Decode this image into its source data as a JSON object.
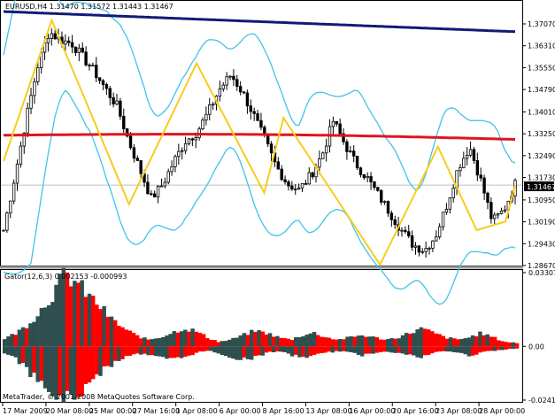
{
  "main": {
    "header": "EURUSD,H4  1.31470 1.31572 1.31443 1.31467",
    "price_ticks": [
      "1.37070",
      "1.36310",
      "1.35550",
      "1.34790",
      "1.34010",
      "1.33250",
      "1.32490",
      "1.31730",
      "1.30950",
      "1.30190",
      "1.29430",
      "1.28670"
    ],
    "current_price": "1.31467"
  },
  "indicator": {
    "header": "Gator(12,6,3) 0.002153 -0.000993",
    "ticks": [
      "0.033079",
      "0.00",
      "-0.024121"
    ]
  },
  "time_axis": {
    "labels": [
      "17 Mar 2009",
      "20 Mar 08:00",
      "25 Mar 00:00",
      "27 Mar 16:00",
      "1 Apr 08:00",
      "6 Apr 00:00",
      "8 Apr 16:00",
      "13 Apr 08:00",
      "16 Apr 00:00",
      "20 Apr 16:00",
      "23 Apr 08:00",
      "28 Apr 00:00"
    ]
  },
  "copyright": "MetaTrader, © 2001-2008 MetaQuotes Software Corp.",
  "colors": {
    "candles": "#000000",
    "bollinger": "#3fc4e8",
    "ma_red": "#e0141e",
    "ma_navy": "#101a78",
    "zigzag": "#f8cc1e",
    "gator_up": "#2f4f4f",
    "gator_down": "#ff0000"
  },
  "chart_data": [
    {
      "type": "candlestick",
      "title": "EURUSD,H4",
      "ylim": [
        1.2867,
        1.3707
      ],
      "x": [
        "17 Mar 2009",
        "20 Mar 08:00",
        "25 Mar 00:00",
        "27 Mar 16:00",
        "1 Apr 08:00",
        "6 Apr 00:00",
        "8 Apr 16:00",
        "13 Apr 08:00",
        "16 Apr 00:00",
        "20 Apr 16:00",
        "23 Apr 08:00",
        "28 Apr 00:00"
      ],
      "close_path": [
        1.299,
        1.318,
        1.338,
        1.356,
        1.368,
        1.365,
        1.364,
        1.359,
        1.354,
        1.348,
        1.342,
        1.33,
        1.32,
        1.31,
        1.315,
        1.323,
        1.33,
        1.333,
        1.34,
        1.348,
        1.353,
        1.347,
        1.339,
        1.33,
        1.321,
        1.315,
        1.313,
        1.318,
        1.325,
        1.337,
        1.329,
        1.322,
        1.317,
        1.311,
        1.305,
        1.299,
        1.294,
        1.292,
        1.297,
        1.308,
        1.321,
        1.328,
        1.316,
        1.302,
        1.306,
        1.315
      ],
      "series": [
        {
          "name": "zigzag",
          "x_index": [
            0,
            5,
            13,
            20,
            27,
            29,
            39,
            45,
            49,
            52,
            53
          ],
          "values": [
            1.323,
            1.372,
            1.308,
            1.357,
            1.312,
            1.338,
            1.287,
            1.328,
            1.299,
            1.302,
            1.3146
          ]
        }
      ]
    },
    {
      "type": "bar",
      "title": "Gator(12,6,3)",
      "ylim": [
        -0.024121,
        0.033079
      ],
      "series": [
        {
          "name": "upper",
          "values_profile": [
            0.0035,
            0.006,
            0.01,
            0.016,
            0.023,
            0.032,
            0.029,
            0.023,
            0.018,
            0.012,
            0.008,
            0.005,
            0.003,
            0.004,
            0.006,
            0.008,
            0.007,
            0.004,
            0.002,
            0.003,
            0.005,
            0.007,
            0.006,
            0.004,
            0.003,
            0.005,
            0.006,
            0.004,
            0.003,
            0.004,
            0.005,
            0.004,
            0.003,
            0.004,
            0.006,
            0.008,
            0.006,
            0.004,
            0.003,
            0.004,
            0.006,
            0.004,
            0.002,
            0.0015
          ]
        },
        {
          "name": "lower",
          "values_profile": [
            -0.003,
            -0.006,
            -0.011,
            -0.017,
            -0.022,
            -0.024,
            -0.022,
            -0.018,
            -0.012,
            -0.008,
            -0.005,
            -0.003,
            -0.004,
            -0.005,
            -0.006,
            -0.005,
            -0.003,
            -0.002,
            -0.003,
            -0.005,
            -0.006,
            -0.005,
            -0.003,
            -0.002,
            -0.004,
            -0.005,
            -0.004,
            -0.003,
            -0.002,
            -0.003,
            -0.004,
            -0.003,
            -0.002,
            -0.003,
            -0.004,
            -0.005,
            -0.003,
            -0.002,
            -0.003,
            -0.004,
            -0.003,
            -0.002,
            -0.0015,
            -0.001
          ]
        }
      ]
    }
  ]
}
